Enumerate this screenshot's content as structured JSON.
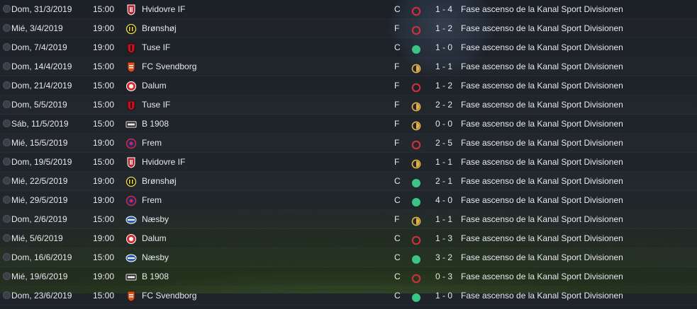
{
  "colors": {
    "win": "#3cc487",
    "draw": "#e3b247",
    "loss": "#c7313a"
  },
  "matches": [
    {
      "date": "Dom, 31/3/2019",
      "time": "15:00",
      "team": "Hvidovre IF",
      "badge": "hvidovre-badge-icon",
      "venue": "C",
      "result": "loss",
      "score": "1 - 4",
      "competition": "Fase ascenso de la Kanal Sport Divisionen"
    },
    {
      "date": "Mié, 3/4/2019",
      "time": "19:00",
      "team": "Brønshøj",
      "badge": "bronshoj-badge-icon",
      "venue": "F",
      "result": "loss",
      "score": "1 - 2",
      "competition": "Fase ascenso de la Kanal Sport Divisionen"
    },
    {
      "date": "Dom, 7/4/2019",
      "time": "19:00",
      "team": "Tuse IF",
      "badge": "tuse-badge-icon",
      "venue": "C",
      "result": "win",
      "score": "1 - 0",
      "competition": "Fase ascenso de la Kanal Sport Divisionen"
    },
    {
      "date": "Dom, 14/4/2019",
      "time": "15:00",
      "team": "FC Svendborg",
      "badge": "svendborg-badge-icon",
      "venue": "F",
      "result": "draw",
      "score": "1 - 1",
      "competition": "Fase ascenso de la Kanal Sport Divisionen"
    },
    {
      "date": "Dom, 21/4/2019",
      "time": "15:00",
      "team": "Dalum",
      "badge": "dalum-badge-icon",
      "venue": "F",
      "result": "loss",
      "score": "1 - 2",
      "competition": "Fase ascenso de la Kanal Sport Divisionen"
    },
    {
      "date": "Dom, 5/5/2019",
      "time": "15:00",
      "team": "Tuse IF",
      "badge": "tuse-badge-icon",
      "venue": "F",
      "result": "draw",
      "score": "2 - 2",
      "competition": "Fase ascenso de la Kanal Sport Divisionen"
    },
    {
      "date": "Sáb, 11/5/2019",
      "time": "15:00",
      "team": "B 1908",
      "badge": "b1908-badge-icon",
      "venue": "F",
      "result": "draw",
      "score": "0 - 0",
      "competition": "Fase ascenso de la Kanal Sport Divisionen"
    },
    {
      "date": "Mié, 15/5/2019",
      "time": "19:00",
      "team": "Frem",
      "badge": "frem-badge-icon",
      "venue": "F",
      "result": "loss",
      "score": "2 - 5",
      "competition": "Fase ascenso de la Kanal Sport Divisionen"
    },
    {
      "date": "Dom, 19/5/2019",
      "time": "15:00",
      "team": "Hvidovre IF",
      "badge": "hvidovre-badge-icon",
      "venue": "F",
      "result": "draw",
      "score": "1 - 1",
      "competition": "Fase ascenso de la Kanal Sport Divisionen"
    },
    {
      "date": "Mié, 22/5/2019",
      "time": "19:00",
      "team": "Brønshøj",
      "badge": "bronshoj-badge-icon",
      "venue": "C",
      "result": "win",
      "score": "2 - 1",
      "competition": "Fase ascenso de la Kanal Sport Divisionen"
    },
    {
      "date": "Mié, 29/5/2019",
      "time": "19:00",
      "team": "Frem",
      "badge": "frem-badge-icon",
      "venue": "C",
      "result": "win",
      "score": "4 - 0",
      "competition": "Fase ascenso de la Kanal Sport Divisionen"
    },
    {
      "date": "Dom, 2/6/2019",
      "time": "15:00",
      "team": "Næsby",
      "badge": "naesby-badge-icon",
      "venue": "F",
      "result": "draw",
      "score": "1 - 1",
      "competition": "Fase ascenso de la Kanal Sport Divisionen"
    },
    {
      "date": "Mié, 5/6/2019",
      "time": "19:00",
      "team": "Dalum",
      "badge": "dalum-badge-icon",
      "venue": "C",
      "result": "loss",
      "score": "1 - 3",
      "competition": "Fase ascenso de la Kanal Sport Divisionen"
    },
    {
      "date": "Dom, 16/6/2019",
      "time": "15:00",
      "team": "Næsby",
      "badge": "naesby-badge-icon",
      "venue": "C",
      "result": "win",
      "score": "3 - 2",
      "competition": "Fase ascenso de la Kanal Sport Divisionen"
    },
    {
      "date": "Mié, 19/6/2019",
      "time": "19:00",
      "team": "B 1908",
      "badge": "b1908-badge-icon",
      "venue": "C",
      "result": "loss",
      "score": "0 - 3",
      "competition": "Fase ascenso de la Kanal Sport Divisionen"
    },
    {
      "date": "Dom, 23/6/2019",
      "time": "15:00",
      "team": "FC Svendborg",
      "badge": "svendborg-badge-icon",
      "venue": "C",
      "result": "win",
      "score": "1 - 0",
      "competition": "Fase ascenso de la Kanal Sport Divisionen"
    }
  ]
}
